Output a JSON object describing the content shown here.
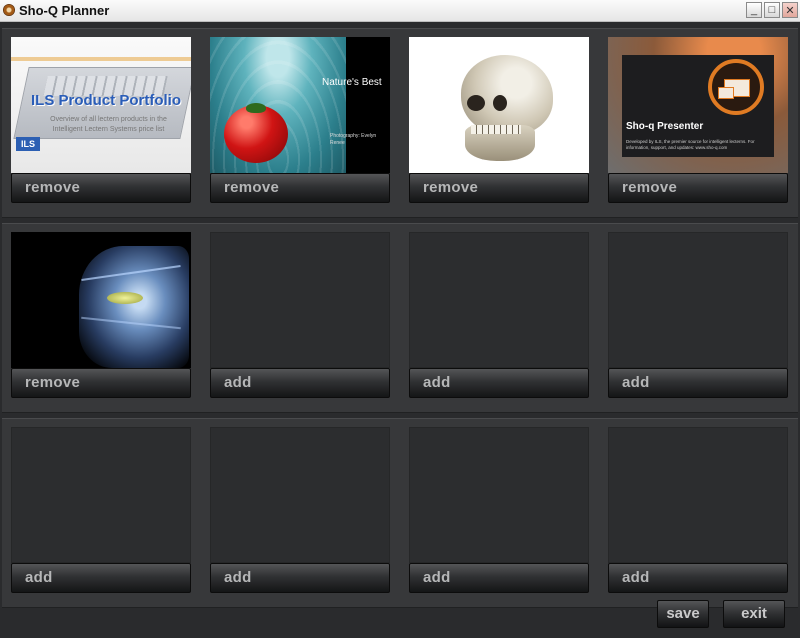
{
  "window": {
    "title": "Sho-Q Planner",
    "controls": {
      "minimize": "_",
      "maximize": "□",
      "close": "✕"
    }
  },
  "slots": [
    {
      "filled": true,
      "button": "remove",
      "thumb": "ils-portfolio",
      "text": {
        "title": "ILS Product Portfolio",
        "subtitle": "Overview of all lectern products in the Intelligent Lectern Systems price list",
        "logo": "ILS"
      }
    },
    {
      "filled": true,
      "button": "remove",
      "thumb": "natures-best",
      "text": {
        "title": "Nature's Best",
        "credit": "Photography: Evelyn Renee"
      }
    },
    {
      "filled": true,
      "button": "remove",
      "thumb": "skull",
      "text": {}
    },
    {
      "filled": true,
      "button": "remove",
      "thumb": "sho-q-presenter",
      "text": {
        "title": "Sho-q Presenter",
        "body": "Developed by ILS, the premier source for intelligent lecterns. For information, support, and updates: www.sho-q.com"
      }
    },
    {
      "filled": true,
      "button": "remove",
      "thumb": "xray-head",
      "text": {}
    },
    {
      "filled": false,
      "button": "add"
    },
    {
      "filled": false,
      "button": "add"
    },
    {
      "filled": false,
      "button": "add"
    },
    {
      "filled": false,
      "button": "add"
    },
    {
      "filled": false,
      "button": "add"
    },
    {
      "filled": false,
      "button": "add"
    },
    {
      "filled": false,
      "button": "add"
    }
  ],
  "footer": {
    "save": "save",
    "exit": "exit"
  }
}
